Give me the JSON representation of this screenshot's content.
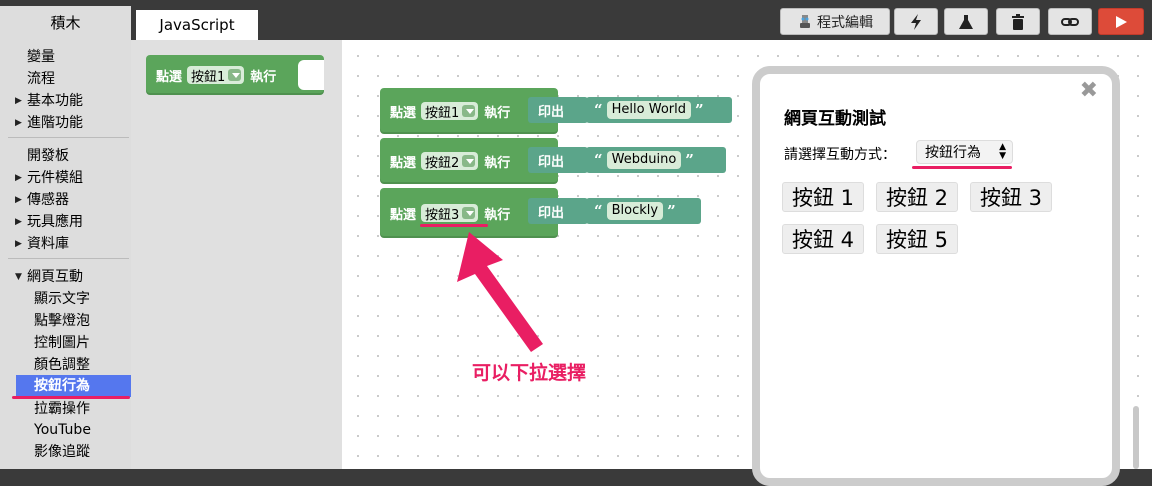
{
  "tabs": {
    "blocks": "積木",
    "javascript": "JavaScript"
  },
  "toolbar": {
    "code_edit": "程式編輯",
    "icons": [
      "pencil-glasses-icon",
      "lightning-icon",
      "flask-icon",
      "trash-icon",
      "link-icon",
      "play-icon"
    ],
    "run_color": "#dd4b39"
  },
  "sidebar": {
    "group1": [
      {
        "label": "變量"
      },
      {
        "label": "流程"
      },
      {
        "label": "基本功能",
        "expandable": true
      },
      {
        "label": "進階功能",
        "expandable": true
      }
    ],
    "group2": [
      {
        "label": "開發板"
      },
      {
        "label": "元件模組",
        "expandable": true
      },
      {
        "label": "傳感器",
        "expandable": true
      },
      {
        "label": "玩具應用",
        "expandable": true
      },
      {
        "label": "資料庫",
        "expandable": true
      }
    ],
    "group3_title": "網頁互動",
    "group3": [
      {
        "label": "顯示文字"
      },
      {
        "label": "點擊燈泡"
      },
      {
        "label": "控制圖片"
      },
      {
        "label": "顏色調整"
      },
      {
        "label": "按鈕行為",
        "selected": true
      },
      {
        "label": "拉霸操作"
      },
      {
        "label": "YouTube"
      },
      {
        "label": "影像追蹤"
      }
    ],
    "selected_color": "#5577ee"
  },
  "flyout": {
    "click": "點選",
    "dropdown": "按鈕1",
    "do": "執行"
  },
  "workspace": {
    "rows": [
      {
        "click": "點選",
        "dropdown": "按鈕1",
        "do": "執行",
        "print": "印出",
        "text": "Hello World"
      },
      {
        "click": "點選",
        "dropdown": "按鈕2",
        "do": "執行",
        "print": "印出",
        "text": "Webduino"
      },
      {
        "click": "點選",
        "dropdown": "按鈕3",
        "do": "執行",
        "print": "印出",
        "text": "Blockly"
      }
    ],
    "open_quote": "“",
    "close_quote": "”",
    "annotation": "可以下拉選擇",
    "annotation_color": "#e91e63"
  },
  "preview": {
    "title": "網頁互動測試",
    "label": "請選擇互動方式：",
    "select_value": "按鈕行為",
    "close": "✖",
    "buttons": [
      "按鈕 1",
      "按鈕 2",
      "按鈕 3",
      "按鈕 4",
      "按鈕 5"
    ]
  },
  "block_color": "#5ba55b",
  "text_block_color": "#5ba58a"
}
